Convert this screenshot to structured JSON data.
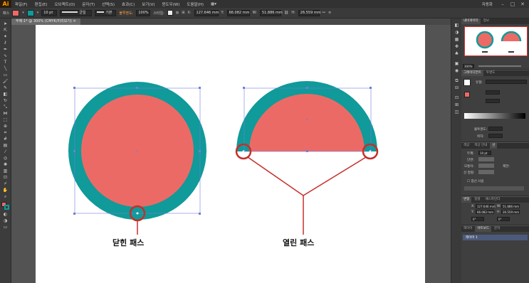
{
  "app": {
    "logo": "Ai",
    "menu": [
      "파일(F)",
      "편집(E)",
      "오브젝트(O)",
      "문자(T)",
      "선택(S)",
      "효과(C)",
      "보기(V)",
      "윈도우(W)",
      "도움말(H)"
    ],
    "workspace": "자동화"
  },
  "control": {
    "stroke_weight": "10 pt",
    "profile": "균일",
    "brush": "기본",
    "style_label": "불투명도:",
    "opacity": "100%",
    "x_label": "X:",
    "x": "127.646 mm",
    "y_label": "Y:",
    "y": "66.082 mm",
    "w_label": "W:",
    "w": "51.886 mm",
    "h_label": "H:",
    "h": "26.559 mm"
  },
  "document": {
    "tab_title": "무제-1* @ 300% (CMYK/미리보기)"
  },
  "canvas": {
    "closed_label": "닫힌 패스",
    "open_label": "열린 패스",
    "fill_color": "#EC6A66",
    "stroke_color": "#109A9A",
    "highlight_color": "#C62F2A"
  },
  "panels": {
    "navigator": {
      "tabs": [
        "내비게이터",
        "정보"
      ],
      "zoom": "300%"
    },
    "gradient": {
      "tabs": [
        "그레이디언트",
        "투명도"
      ],
      "type_label": "유형:",
      "opacity_label": "불투명도:",
      "position_label": "위치:"
    },
    "stroke": {
      "tabs": [
        "색상",
        "색상 안내",
        "선"
      ],
      "weight_label": "두께:",
      "weight": "10 pt",
      "cap_label": "단면:",
      "corner_label": "모퉁이:",
      "limit_label": "제한:",
      "align_label": "선 정렬:",
      "dash_label": "점선 사용"
    },
    "transform": {
      "tabs": [
        "변형",
        "정렬",
        "패스파인더"
      ],
      "x_label": "X:",
      "x": "127.646 mm",
      "y_label": "Y:",
      "y": "66.082 mm",
      "w_label": "W:",
      "w": "51.886 mm",
      "h_label": "H:",
      "h": "26.559 mm",
      "angle": "0°",
      "shear": "0°"
    },
    "layers": {
      "tabs": [
        "레이어",
        "아트보드",
        "문자"
      ],
      "layer_name": "레이어 1"
    }
  }
}
